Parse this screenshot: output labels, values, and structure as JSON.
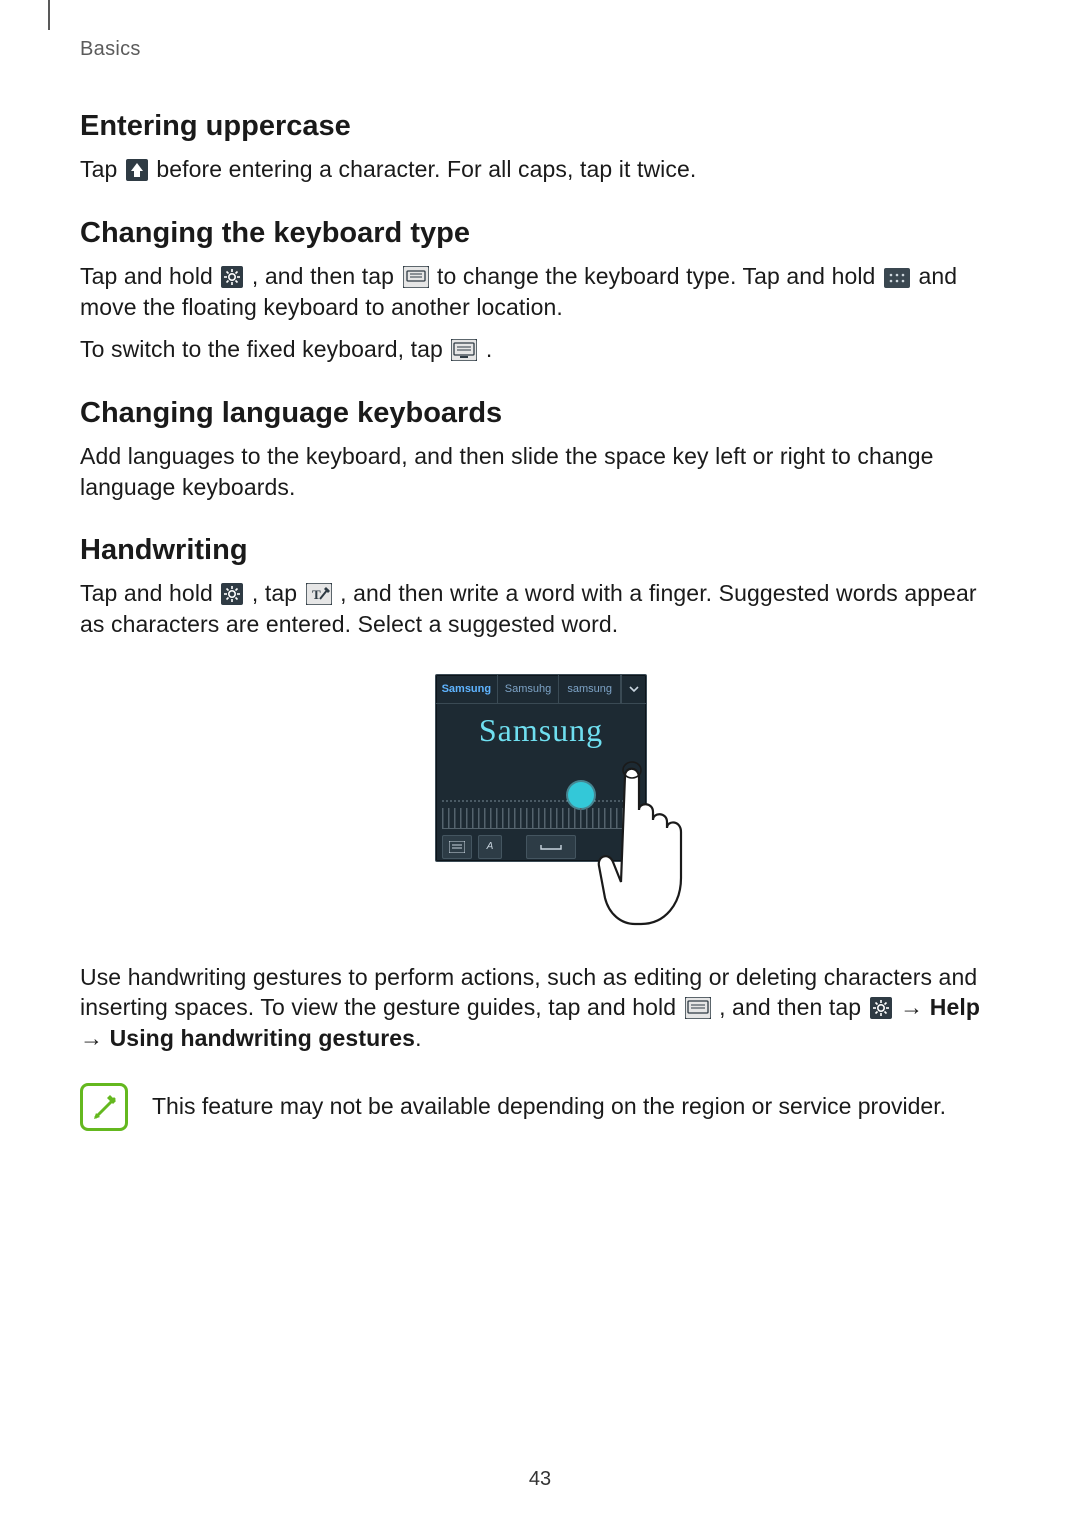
{
  "header": {
    "breadcrumb": "Basics"
  },
  "sections": {
    "uppercase": {
      "title": "Entering uppercase",
      "body_a": "Tap ",
      "body_b": " before entering a character. For all caps, tap it twice."
    },
    "kbtype": {
      "title": "Changing the keyboard type",
      "p1_a": "Tap and hold ",
      "p1_b": ", and then tap ",
      "p1_c": " to change the keyboard type. Tap and hold ",
      "p1_d": " and move the floating keyboard to another location.",
      "p2_a": "To switch to the fixed keyboard, tap ",
      "p2_b": "."
    },
    "lang": {
      "title": "Changing language keyboards",
      "p1": "Add languages to the keyboard, and then slide the space key left or right to change language keyboards."
    },
    "hand": {
      "title": "Handwriting",
      "p1_a": "Tap and hold ",
      "p1_b": ", tap ",
      "p1_c": ", and then write a word with a finger. Suggested words appear as characters are entered. Select a suggested word.",
      "p2_a": "Use handwriting gestures to perform actions, such as editing or deleting characters and inserting spaces. To view the gesture guides, tap and hold ",
      "p2_b": ", and then tap ",
      "p2_c": " → ",
      "p2_help": "Help",
      "p2_d": " → ",
      "p2_gest": "Using handwriting gestures",
      "p2_e": "."
    }
  },
  "figure": {
    "suggestions": [
      "Samsung",
      "Samsuhg",
      "samsung"
    ],
    "written": "Samsung"
  },
  "note": {
    "text": "This feature may not be available depending on the region or service provider."
  },
  "page_number": "43"
}
